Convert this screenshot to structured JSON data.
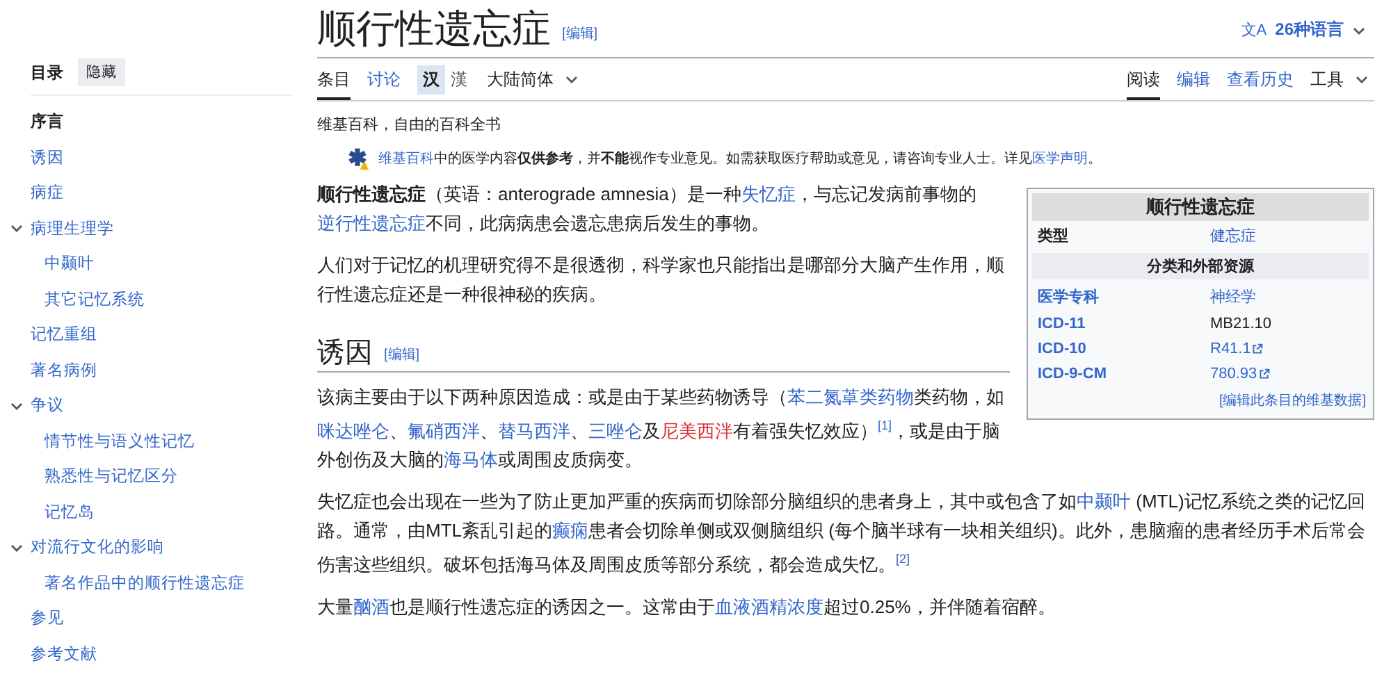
{
  "title": "顺行性遗忘症",
  "title_edit": "[编辑]",
  "languages": {
    "icon": "文A",
    "label": "26种语言"
  },
  "toc": {
    "title": "目录",
    "hide_button": "隐藏",
    "items": [
      {
        "label": "序言",
        "selected": true
      },
      {
        "label": "诱因",
        "selected": false
      },
      {
        "label": "病症",
        "selected": false
      },
      {
        "label": "病理生理学",
        "selected": false,
        "expanded": true,
        "children": [
          {
            "label": "中颞叶",
            "selected": false
          },
          {
            "label": "其它记忆系统",
            "selected": false
          }
        ]
      },
      {
        "label": "记忆重组",
        "selected": false
      },
      {
        "label": "著名病例",
        "selected": false
      },
      {
        "label": "争议",
        "selected": false,
        "expanded": true,
        "children": [
          {
            "label": "情节性与语义性记忆",
            "selected": false
          },
          {
            "label": "熟悉性与记忆区分",
            "selected": false
          },
          {
            "label": "记忆岛",
            "selected": false
          }
        ]
      },
      {
        "label": "对流行文化的影响",
        "selected": false,
        "expanded": true,
        "children": [
          {
            "label": "著名作品中的顺行性遗忘症",
            "selected": false
          }
        ]
      },
      {
        "label": "参见",
        "selected": false
      },
      {
        "label": "参考文献",
        "selected": false
      }
    ]
  },
  "tabs_left": [
    {
      "label": "条目",
      "selected": true
    },
    {
      "label": "讨论",
      "selected": false
    }
  ],
  "variants": [
    {
      "label": "汉",
      "selected": true
    },
    {
      "label": "漢",
      "selected": false
    }
  ],
  "variant_dropdown": "大陆简体",
  "tabs_right": [
    {
      "label": "阅读",
      "selected": true
    },
    {
      "label": "编辑",
      "selected": false
    },
    {
      "label": "查看历史",
      "selected": false
    }
  ],
  "tools_dropdown": "工具",
  "tagline": "维基百科，自由的百科全书",
  "notice": [
    {
      "text": "维基百科",
      "kind": "link"
    },
    {
      "text": "中的医学内容",
      "kind": "plain"
    },
    {
      "text": "仅供参考",
      "kind": "bold"
    },
    {
      "text": "，并",
      "kind": "plain"
    },
    {
      "text": "不能",
      "kind": "bold"
    },
    {
      "text": "视作专业意见。如需获取医疗帮助或意见，请咨询专业人士。详见",
      "kind": "plain"
    },
    {
      "text": "医学声明",
      "kind": "link"
    },
    {
      "text": "。",
      "kind": "plain"
    }
  ],
  "infobox": {
    "title": "顺行性遗忘症",
    "rows": [
      {
        "kind": "row",
        "label": "类型",
        "label_link": false,
        "value": "健忘症",
        "value_link": true,
        "external": false
      },
      {
        "kind": "header",
        "label": "分类和外部资源"
      },
      {
        "kind": "row",
        "label": "医学专科",
        "label_link": true,
        "value": "神经学",
        "value_link": true,
        "external": false
      },
      {
        "kind": "row",
        "label": "ICD-11",
        "label_link": true,
        "value": "MB21.10",
        "value_link": false,
        "external": false
      },
      {
        "kind": "row",
        "label": "ICD-10",
        "label_link": true,
        "value": "R41.1",
        "value_link": true,
        "external": true
      },
      {
        "kind": "row",
        "label": "ICD-9-CM",
        "label_link": true,
        "value": "780.93",
        "value_link": true,
        "external": true
      }
    ],
    "footer_link": "[编辑此条目的维基数据]"
  },
  "intro": [
    [
      {
        "text": "顺行性遗忘症",
        "kind": "bold"
      },
      {
        "text": "（英语：anterograde amnesia）是一种",
        "kind": "plain"
      },
      {
        "text": "失忆症",
        "kind": "link"
      },
      {
        "text": "，与忘记发病前事物的",
        "kind": "plain"
      },
      {
        "text": "逆行性遗忘症",
        "kind": "link"
      },
      {
        "text": "不同，此病病患会遗忘患病后发生的事物。",
        "kind": "plain"
      }
    ],
    [
      {
        "text": "人们对于记忆的机理研究得不是很透彻，科学家也只能指出是哪部分大脑产生作用，顺行性遗忘症还是一种很神秘的疾病。",
        "kind": "plain"
      }
    ]
  ],
  "section": {
    "heading": "诱因",
    "edit": "[编辑]",
    "paragraphs": [
      [
        {
          "text": "该病主要由于以下两种原因造成：或是由于某些药物诱导（",
          "kind": "plain"
        },
        {
          "text": "苯二氮䓬类药物",
          "kind": "link"
        },
        {
          "text": "类药物，如",
          "kind": "plain"
        },
        {
          "text": "咪达唑仑",
          "kind": "link"
        },
        {
          "text": "、",
          "kind": "plain"
        },
        {
          "text": "氟硝西泮",
          "kind": "link"
        },
        {
          "text": "、",
          "kind": "plain"
        },
        {
          "text": "替马西泮",
          "kind": "link"
        },
        {
          "text": "、",
          "kind": "plain"
        },
        {
          "text": "三唑仑",
          "kind": "link"
        },
        {
          "text": "及",
          "kind": "plain"
        },
        {
          "text": "尼美西泮",
          "kind": "red_link"
        },
        {
          "text": "有着强失忆效应）",
          "kind": "plain"
        },
        {
          "text": "[1]",
          "kind": "ref"
        },
        {
          "text": "，或是由于脑外创伤及大脑的",
          "kind": "plain"
        },
        {
          "text": "海马体",
          "kind": "link"
        },
        {
          "text": "或周围皮质病变。",
          "kind": "plain"
        }
      ],
      [
        {
          "text": "失忆症也会出现在一些为了防止更加严重的疾病而切除部分脑组织的患者身上，其中或包含了如",
          "kind": "plain"
        },
        {
          "text": "中颞叶",
          "kind": "link"
        },
        {
          "text": " (MTL)记忆系统之类的记忆回路。通常，由MTL紊乱引起的",
          "kind": "plain"
        },
        {
          "text": "癫痫",
          "kind": "link"
        },
        {
          "text": "患者会切除单侧或双侧脑组织 (每个脑半球有一块相关组织)。此外，患脑瘤的患者经历手术后常会伤害这些组织。破坏包括海马体及周围皮质等部分系统，都会造成失忆。",
          "kind": "plain"
        },
        {
          "text": "[2]",
          "kind": "ref"
        }
      ],
      [
        {
          "text": "大量",
          "kind": "plain"
        },
        {
          "text": "酗酒",
          "kind": "link"
        },
        {
          "text": "也是顺行性遗忘症的诱因之一。这常由于",
          "kind": "plain"
        },
        {
          "text": "血液酒精浓度",
          "kind": "link"
        },
        {
          "text": "超过0.25%，并伴随着宿醉。",
          "kind": "plain"
        }
      ]
    ]
  }
}
